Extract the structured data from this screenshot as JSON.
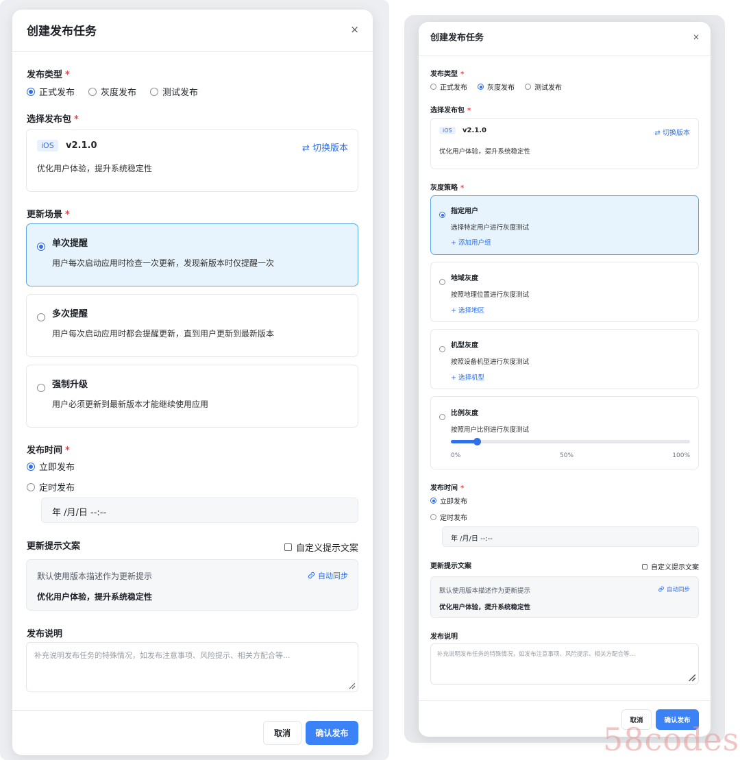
{
  "left": {
    "title": "创建发布任务",
    "close": "×",
    "release_type": {
      "label": "发布类型",
      "required": "*",
      "options": [
        "正式发布",
        "灰度发布",
        "测试发布"
      ],
      "selected": "正式发布"
    },
    "package": {
      "label": "选择发布包",
      "required": "*",
      "platform": "iOS",
      "version": "v2.1.0",
      "switch_icon": "⇄",
      "switch_label": "切换版本",
      "description": "优化用户体验，提升系统稳定性"
    },
    "scene": {
      "label": "更新场景",
      "required": "*",
      "options": [
        {
          "title": "单次提醒",
          "desc": "用户每次启动应用时检查一次更新，发现新版本时仅提醒一次"
        },
        {
          "title": "多次提醒",
          "desc": "用户每次启动应用时都会提醒更新，直到用户更新到最新版本"
        },
        {
          "title": "强制升级",
          "desc": "用户必须更新到最新版本才能继续使用应用"
        }
      ],
      "selected": "单次提醒"
    },
    "time": {
      "label": "发布时间",
      "required": "*",
      "options": [
        "立即发布",
        "定时发布"
      ],
      "selected": "立即发布",
      "datetime_placeholder": "年 /月/日 --:--"
    },
    "prompt": {
      "label": "更新提示文案",
      "custom_label": "自定义提示文案",
      "default_note": "默认使用版本描述作为更新提示",
      "sync_icon": "link-icon",
      "sync_label": "自动同步",
      "text": "优化用户体验，提升系统稳定性"
    },
    "notes": {
      "label": "发布说明",
      "placeholder": "补充说明发布任务的特殊情况，如发布注意事项、风险提示、相关方配合等..."
    },
    "footer": {
      "cancel": "取消",
      "confirm": "确认发布"
    }
  },
  "right": {
    "title": "创建发布任务",
    "close": "×",
    "release_type": {
      "label": "发布类型",
      "required": "*",
      "options": [
        "正式发布",
        "灰度发布",
        "测试发布"
      ],
      "selected": "灰度发布"
    },
    "package": {
      "label": "选择发布包",
      "required": "*",
      "platform": "iOS",
      "version": "v2.1.0",
      "switch_icon": "⇄",
      "switch_label": "切换版本",
      "description": "优化用户体验，提升系统稳定性"
    },
    "strategy": {
      "label": "灰度策略",
      "required": "*",
      "options": [
        {
          "title": "指定用户",
          "desc": "选择特定用户进行灰度测试",
          "action": "+ 添加用户组"
        },
        {
          "title": "地域灰度",
          "desc": "按照地理位置进行灰度测试",
          "action": "+ 选择地区"
        },
        {
          "title": "机型灰度",
          "desc": "按照设备机型进行灰度测试",
          "action": "+ 选择机型"
        },
        {
          "title": "比例灰度",
          "desc": "按照用户比例进行灰度测试",
          "action": ""
        }
      ],
      "selected": "指定用户",
      "slider": {
        "value_percent": 11,
        "ticks": [
          "0%",
          "50%",
          "100%"
        ]
      }
    },
    "time": {
      "label": "发布时间",
      "required": "*",
      "options": [
        "立即发布",
        "定时发布"
      ],
      "selected": "立即发布",
      "datetime_placeholder": "年 /月/日 --:--"
    },
    "prompt": {
      "label": "更新提示文案",
      "custom_label": "自定义提示文案",
      "default_note": "默认使用版本描述作为更新提示",
      "sync_icon": "link-icon",
      "sync_label": "自动同步",
      "text": "优化用户体验，提升系统稳定性"
    },
    "notes": {
      "label": "发布说明",
      "placeholder": "补充说明发布任务的特殊情况，如发布注意事项、风险提示、相关方配合等..."
    },
    "footer": {
      "cancel": "取消",
      "confirm": "确认发布"
    }
  },
  "watermark": "58codes",
  "colors": {
    "primary": "#3b82f6",
    "selected_card_bg": "#e8f4fd",
    "selected_card_border": "#5aa9e6",
    "required": "#e5484d"
  }
}
